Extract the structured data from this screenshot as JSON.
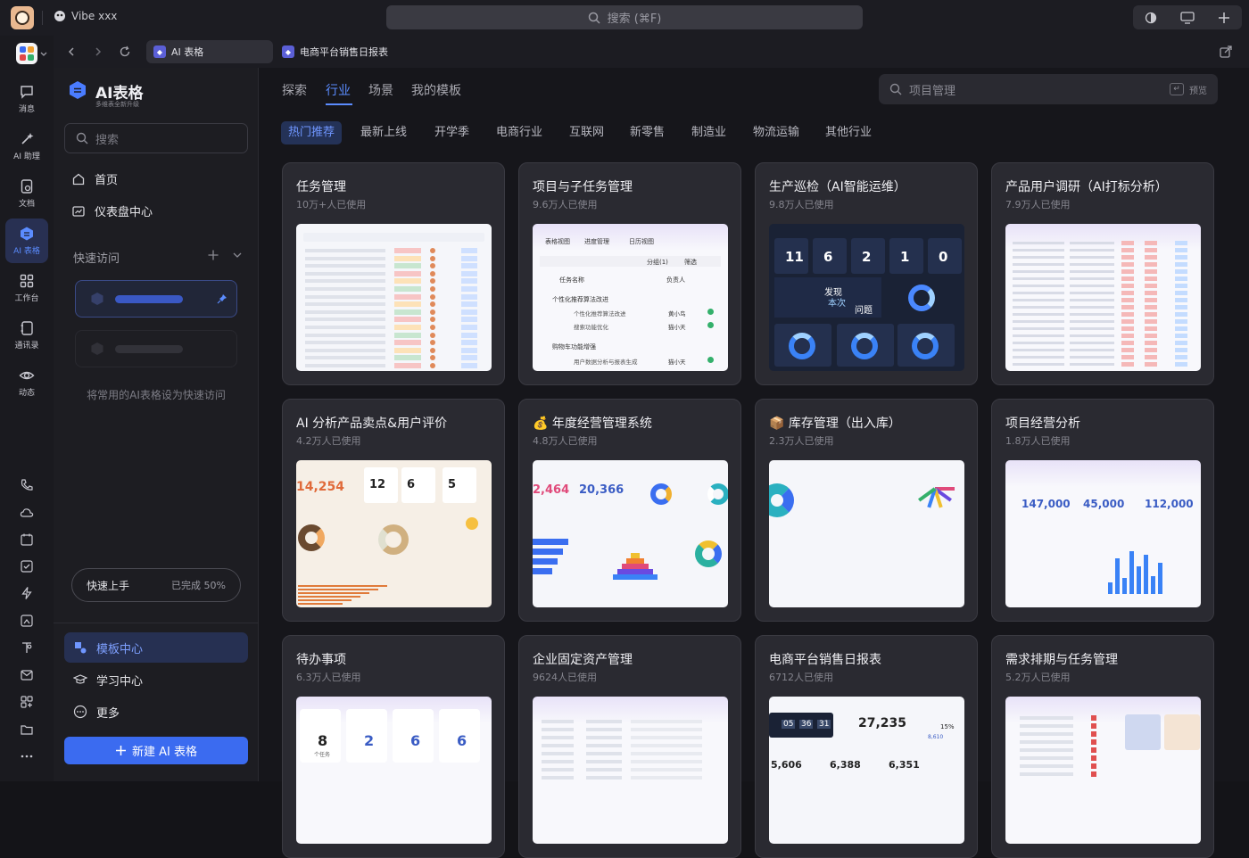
{
  "app": {
    "name": "Vibe xxx",
    "search_placeholder": "搜索 (⌘F)"
  },
  "rail": [
    {
      "label": "消息",
      "icon": "message-icon"
    },
    {
      "label": "AI 助理",
      "icon": "ai-sparkle-icon"
    },
    {
      "label": "文档",
      "icon": "document-icon"
    },
    {
      "label": "AI 表格",
      "icon": "ai-table-icon"
    },
    {
      "label": "工作台",
      "icon": "workbench-icon"
    },
    {
      "label": "通讯录",
      "icon": "contacts-icon"
    },
    {
      "label": "动态",
      "icon": "eye-icon"
    }
  ],
  "tabs": [
    {
      "label": "AI 表格"
    },
    {
      "label": "电商平台销售日报表"
    }
  ],
  "sidebar": {
    "title": "AI表格",
    "subtitle": "多维表全新升级",
    "search_placeholder": "搜索",
    "home": "首页",
    "dashboard": "仪表盘中心",
    "quick_access": "快速访问",
    "quick_hint": "将常用的AI表格设为快速访问",
    "progress_label": "快速上手",
    "progress_value": "已完成 50%",
    "progress_pct": 50,
    "template_center": "模板中心",
    "learning_center": "学习中心",
    "more": "更多",
    "new_button": "新建 AI 表格"
  },
  "main": {
    "tabs": [
      "探索",
      "行业",
      "场景",
      "我的模板"
    ],
    "active_tab": "行业",
    "search_placeholder": "项目管理",
    "search_hint": "预览",
    "chips": [
      "热门推荐",
      "最新上线",
      "开学季",
      "电商行业",
      "互联网",
      "新零售",
      "制造业",
      "物流运输",
      "其他行业"
    ],
    "cards": [
      {
        "title": "任务管理",
        "usage": "10万+人已使用"
      },
      {
        "title": "项目与子任务管理",
        "usage": "9.6万人已使用"
      },
      {
        "title": "生产巡检（AI智能运维）",
        "usage": "9.8万人已使用"
      },
      {
        "title": "产品用户调研（AI打标分析）",
        "usage": "7.9万人已使用"
      },
      {
        "title": "AI 分析产品卖点&用户评价",
        "usage": "4.2万人已使用"
      },
      {
        "title": "💰 年度经营管理系统",
        "usage": "4.8万人已使用"
      },
      {
        "title": "📦 库存管理（出入库）",
        "usage": "2.3万人已使用"
      },
      {
        "title": "项目经营分析",
        "usage": "1.8万人已使用"
      },
      {
        "title": "待办事项",
        "usage": "6.3万人已使用"
      },
      {
        "title": "企业固定资产管理",
        "usage": "9624人已使用"
      },
      {
        "title": "电商平台销售日报表",
        "usage": "6712人已使用"
      },
      {
        "title": "需求排期与任务管理",
        "usage": "5.2万人已使用"
      }
    ],
    "thumb_text": {
      "project_views": [
        "表格视图",
        "进度管理",
        "日历视图"
      ],
      "project_tools": [
        "分组(1)",
        "筛选"
      ],
      "project_cols": [
        "任务名称",
        "负责人"
      ],
      "project_groups": [
        "个性化推荐算法改进",
        "购物车功能增强"
      ],
      "project_rows": [
        "个性化推荐算法改进",
        "搜索功能优化",
        "用户数据分析与报表生成"
      ],
      "project_people": [
        "黄小鸟",
        "猫小天",
        "猫小天"
      ],
      "inspect_nums": [
        "11",
        "6",
        "2",
        "1",
        "0"
      ],
      "inspect_caption": [
        "发现",
        "本次",
        "问题"
      ],
      "ai_nums": [
        "14,254",
        "12",
        "6",
        "5"
      ],
      "annual_nums": [
        "2,464",
        "20,366"
      ],
      "proj_nums": [
        "147,000",
        "45,000",
        "112,000"
      ],
      "todo_nums": [
        "8",
        "2",
        "6",
        "6"
      ],
      "todo_sub": "个任务",
      "sales_nums": [
        "05",
        "36",
        "31"
      ],
      "sales_total": "27,235",
      "sales_pct": "15%",
      "sales_sub": "8,610",
      "sales_bottom": [
        "5,606",
        "6,388",
        "6,351"
      ]
    }
  },
  "colors": {
    "accent": "#5b8cff",
    "new_button": "#3b6bf0",
    "active_bg": "#263052"
  }
}
